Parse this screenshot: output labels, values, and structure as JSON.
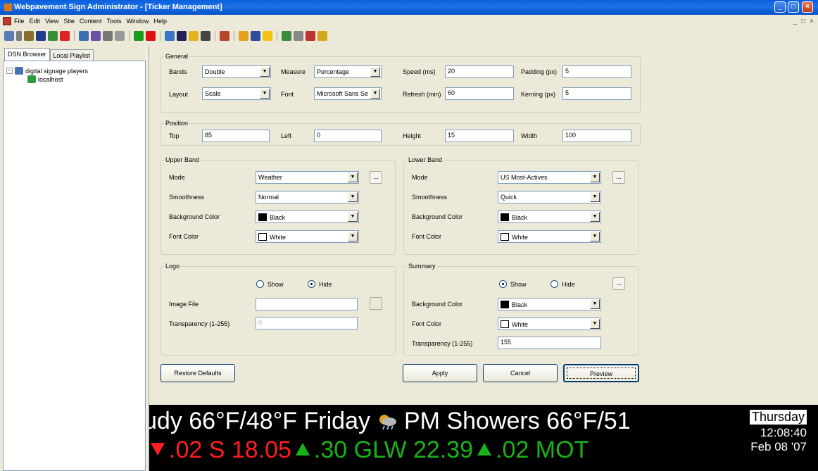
{
  "window": {
    "title": "Webpavement Sign Administrator - [Ticker Management]",
    "accent": "#0a5fdc"
  },
  "menu": [
    "File",
    "Edit",
    "View",
    "Site",
    "Content",
    "Tools",
    "Window",
    "Help"
  ],
  "mdi_controls": [
    "_",
    "□",
    "×"
  ],
  "tabs": [
    "DSN Browser",
    "Local Playlist"
  ],
  "tree": {
    "root": "digital signage players",
    "expander": "−",
    "child": "localhost"
  },
  "general": {
    "legend": "General",
    "bands_label": "Bands",
    "bands_value": "Double",
    "measure_label": "Measure",
    "measure_value": "Percentage",
    "speed_label": "Speed (ms)",
    "speed_value": "20",
    "padding_label": "Padding (px)",
    "padding_value": "5",
    "layout_label": "Layout",
    "layout_value": "Scale",
    "font_label": "Font",
    "font_value": "Microsoft Sans Se",
    "refresh_label": "Refresh (min)",
    "refresh_value": "60",
    "kerning_label": "Kerning (px)",
    "kerning_value": "5"
  },
  "position": {
    "legend": "Position",
    "top_label": "Top",
    "top_value": "85",
    "left_label": "Left",
    "left_value": "0",
    "height_label": "Height",
    "height_value": "15",
    "width_label": "Width",
    "width_value": "100"
  },
  "upper_band": {
    "legend": "Upper Band",
    "mode_label": "Mode",
    "mode_value": "Weather",
    "smooth_label": "Smoothness",
    "smooth_value": "Normal",
    "bg_label": "Background Color",
    "bg_value": "Black",
    "fc_label": "Font Color",
    "fc_value": "White"
  },
  "lower_band": {
    "legend": "Lower Band",
    "mode_label": "Mode",
    "mode_value": "US Most-Actives",
    "smooth_label": "Smoothness",
    "smooth_value": "Quick",
    "bg_label": "Background Color",
    "bg_value": "Black",
    "fc_label": "Font Color",
    "fc_value": "White"
  },
  "logo": {
    "legend": "Logo",
    "show": "Show",
    "hide": "Hide",
    "image_label": "Image File",
    "image_value": "",
    "trans_label": "Transparency (1-255)",
    "trans_value": "0"
  },
  "summary": {
    "legend": "Summary",
    "show": "Show",
    "hide": "Hide",
    "bg_label": "Background Color",
    "bg_value": "Black",
    "fc_label": "Font Color",
    "fc_value": "White",
    "trans_label": "Transparency (1-255)",
    "trans_value": "155"
  },
  "buttons": {
    "restore": "Restore Defaults",
    "apply": "Apply",
    "cancel": "Cancel",
    "preview": "Preview",
    "more": "..."
  },
  "ticker": {
    "upper_a": "udy  66°F/48°F  Friday",
    "upper_b": "PM Showers  66°F/51",
    "lower_a": ".02  S 18.05",
    "lower_b": ".30  GLW 22.39",
    "lower_c": ".02  MOT",
    "summary_day": "Thursday",
    "summary_time": "12:08:40",
    "summary_date": "Feb 08 '07"
  }
}
